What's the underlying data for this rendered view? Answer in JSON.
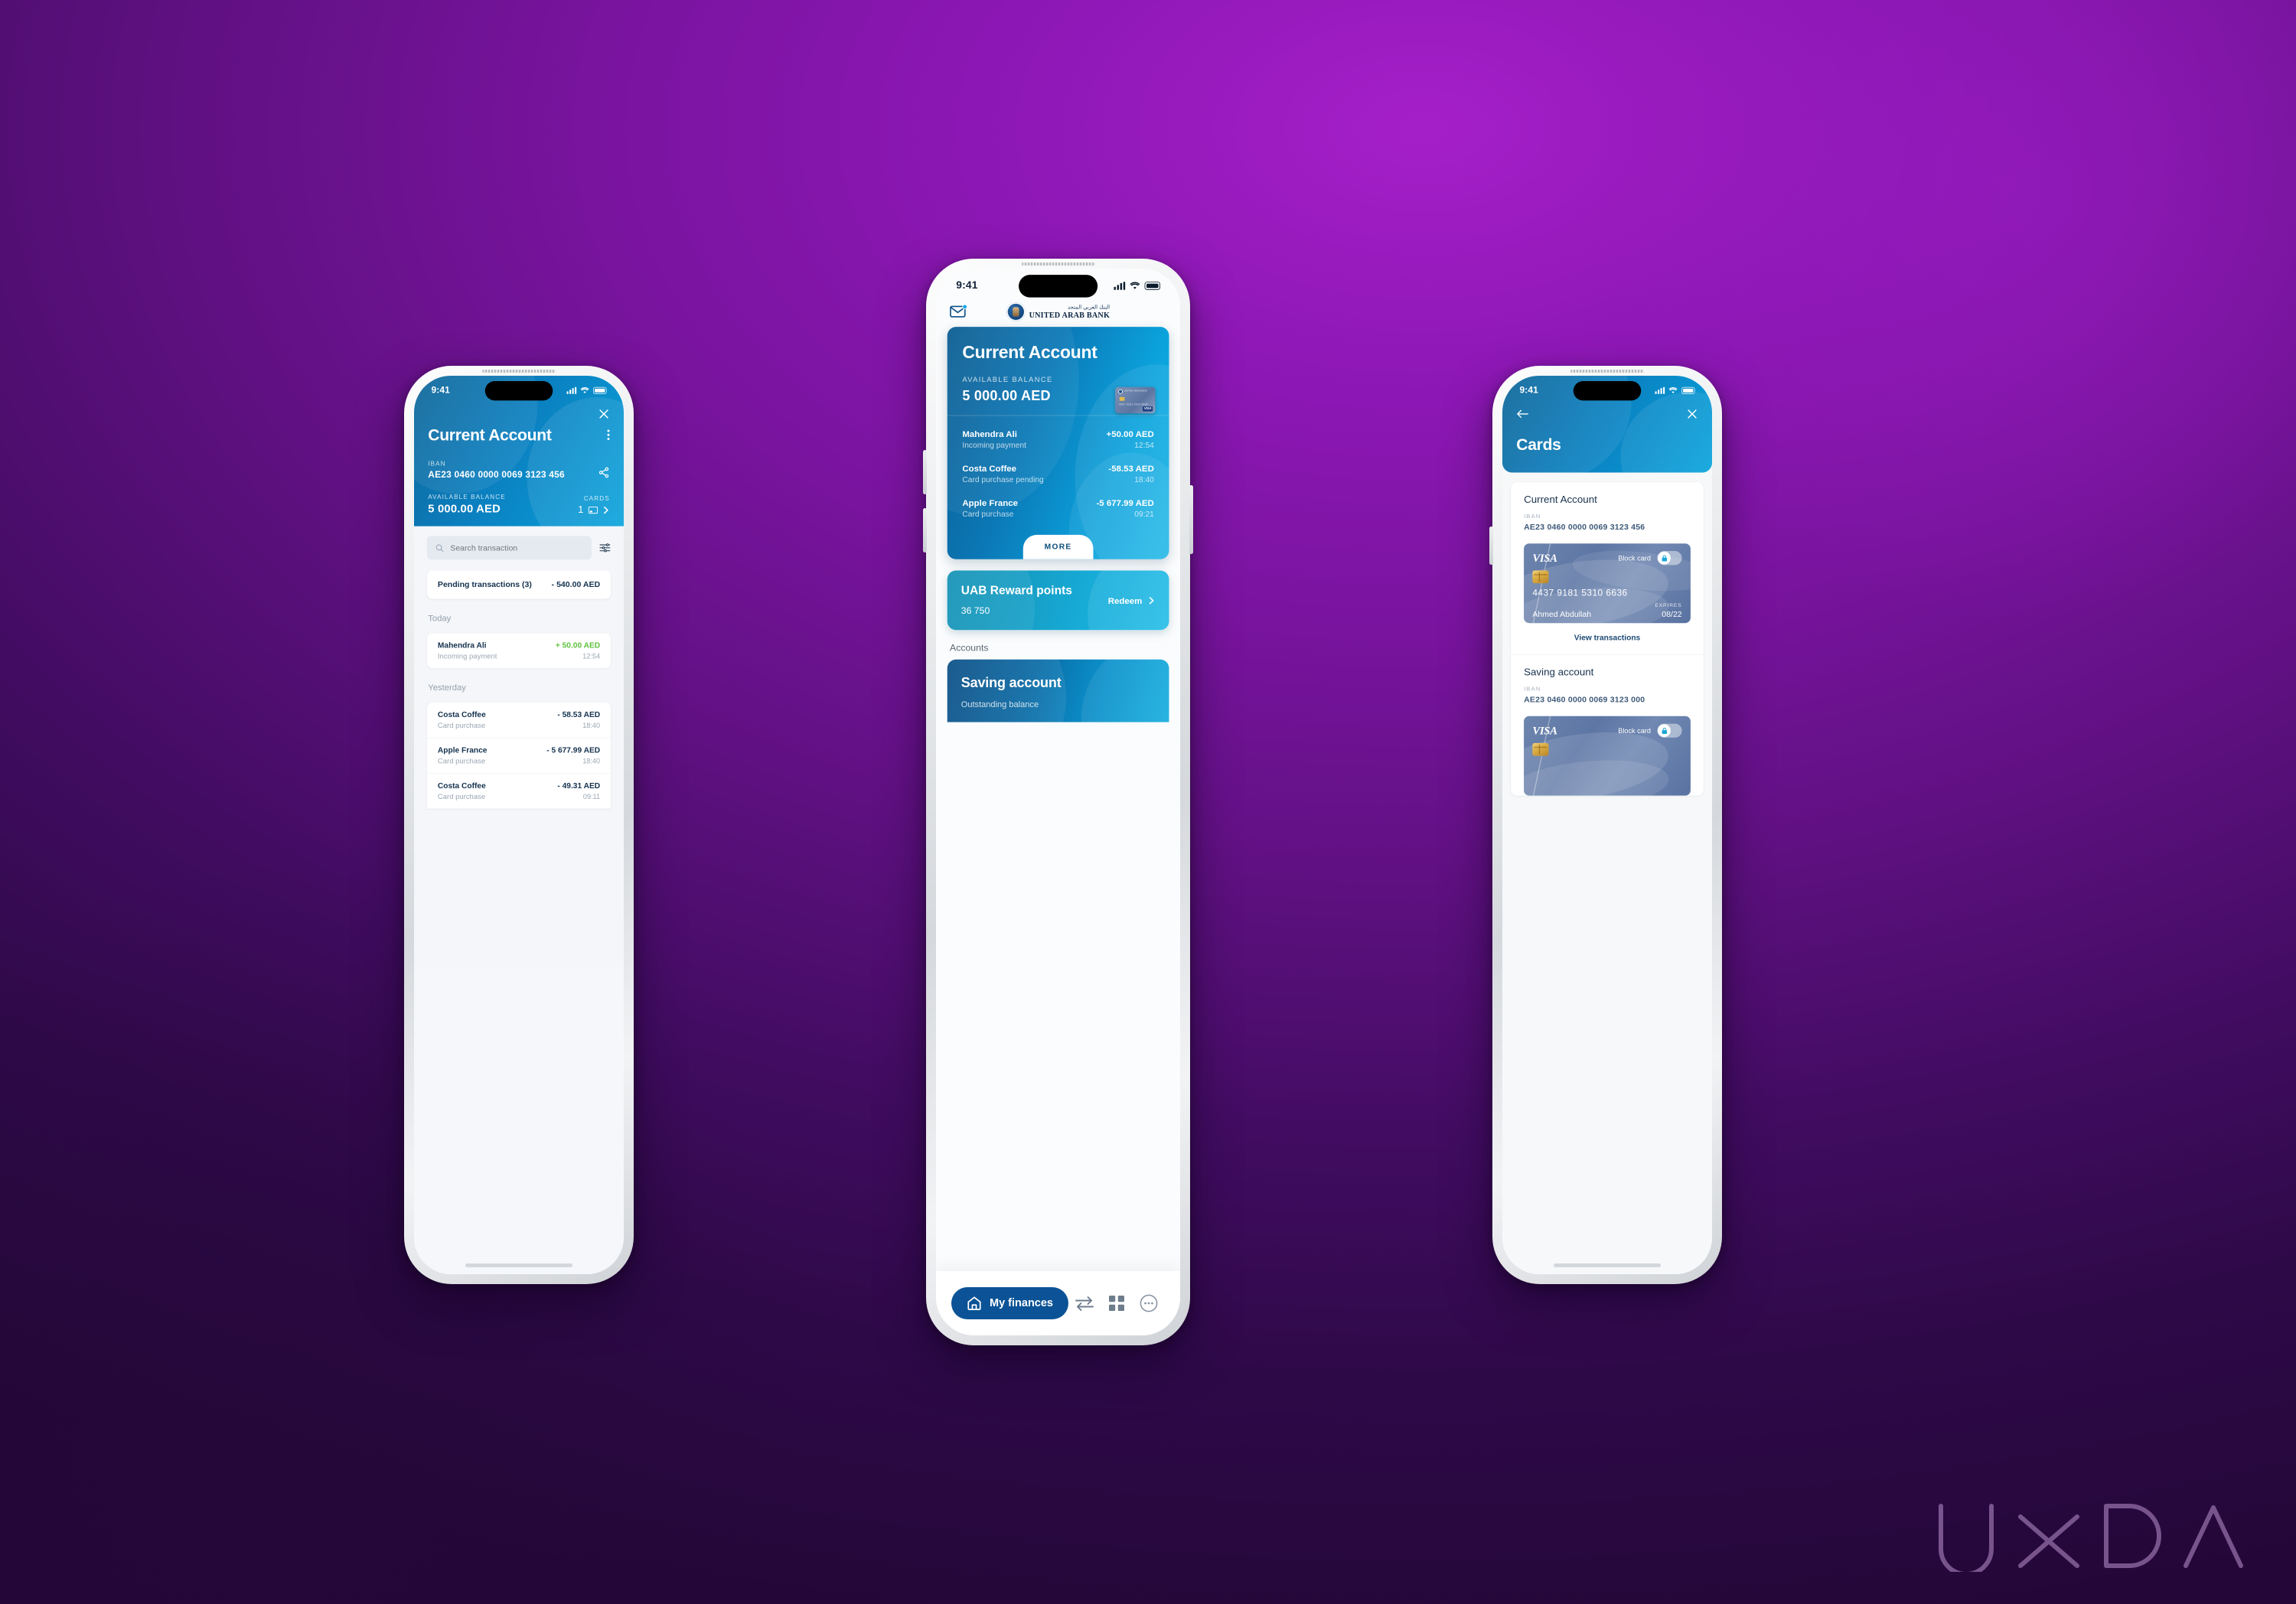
{
  "background": {
    "accent_purple": "#8415ad",
    "deep_purple": "#2a0b4e"
  },
  "brand": {
    "name_en": "UNITED ARAB BANK",
    "name_ar": "البنك العربي المتحد",
    "accent_blue": "#0b7fbf",
    "dark_blue": "#0b5396"
  },
  "watermark": {
    "text": "UXDA"
  },
  "status_bar": {
    "time": "9:41"
  },
  "left_phone": {
    "header": {
      "title": "Current Account",
      "iban_label": "IBAN",
      "iban_value": "AE23 0460 0000 0069 3123 456",
      "balance_label": "AVAILABLE BALANCE",
      "balance_value": "5 000.00 AED",
      "cards_label": "CARDS",
      "cards_count": "1",
      "close_icon": "close-icon",
      "menu_icon": "more-vertical-icon",
      "share_icon": "share-icon",
      "chevron_icon": "chevron-right-icon"
    },
    "search": {
      "placeholder": "Search transaction",
      "value": "",
      "filter_icon": "filter-sliders-icon",
      "search_icon": "search-icon"
    },
    "pending": {
      "label": "Pending transactions (3)",
      "amount": "- 540.00 AED"
    },
    "groups": [
      {
        "label": "Today",
        "items": [
          {
            "name": "Mahendra Ali",
            "subtitle": "Incoming payment",
            "amount": "+ 50.00 AED",
            "time": "12:54",
            "positive": true
          }
        ]
      },
      {
        "label": "Yesterday",
        "items": [
          {
            "name": "Costa Coffee",
            "subtitle": "Card purchase",
            "amount": "- 58.53 AED",
            "time": "18:40",
            "positive": false
          },
          {
            "name": "Apple France",
            "subtitle": "Card purchase",
            "amount": "- 5 677.99 AED",
            "time": "18:40",
            "positive": false
          },
          {
            "name": "Costa Coffee",
            "subtitle": "Card purchase",
            "amount": "- 49.31 AED",
            "time": "09:11",
            "positive": false
          }
        ]
      }
    ]
  },
  "center_phone": {
    "mail_icon": "mail-icon",
    "account_card": {
      "title": "Current Account",
      "balance_label": "AVAILABLE BALANCE",
      "balance_value": "5 000.00 AED",
      "more_label": "MORE",
      "transactions": [
        {
          "name": "Mahendra Ali",
          "subtitle": "Incoming payment",
          "amount": "+50.00 AED",
          "time": "12:54"
        },
        {
          "name": "Costa Coffee",
          "subtitle": "Card purchase pending",
          "amount": "-58.53 AED",
          "time": "18:40"
        },
        {
          "name": "Apple France",
          "subtitle": "Card purchase",
          "amount": "-5 677.99 AED",
          "time": "09:21"
        }
      ]
    },
    "rewards": {
      "title": "UAB Reward points",
      "points": "36 750",
      "action": "Redeem",
      "chevron_icon": "chevron-right-icon"
    },
    "accounts_heading": "Accounts",
    "saving_card": {
      "title": "Saving account",
      "subtitle": "Outstanding balance"
    },
    "tabbar": [
      {
        "label": "My finances",
        "icon": "home-icon",
        "active": true
      },
      {
        "label": "",
        "icon": "transfer-arrows-icon",
        "active": false
      },
      {
        "label": "",
        "icon": "grid-apps-icon",
        "active": false
      },
      {
        "label": "",
        "icon": "more-circle-icon",
        "active": false
      }
    ]
  },
  "right_phone": {
    "header": {
      "title": "Cards",
      "back_icon": "arrow-left-icon",
      "close_icon": "close-icon"
    },
    "sections": [
      {
        "title": "Current Account",
        "iban_label": "IBAN",
        "iban_value": "AE23 0460 0000 0069 3123 456",
        "card": {
          "brand": "VISA",
          "block_label": "Block card",
          "lock_icon": "lock-icon",
          "number": "4437 9181 5310 6636",
          "holder": "Ahmed Abdullah",
          "expires_label": "EXPIRES",
          "expires_value": "08/22"
        },
        "view_transactions": "View transactions"
      },
      {
        "title": "Saving account",
        "iban_label": "IBAN",
        "iban_value": "AE23 0460 0000 0069 3123 000",
        "card": {
          "brand": "VISA",
          "block_label": "Block card",
          "lock_icon": "lock-icon",
          "number": "",
          "holder": "",
          "expires_label": "",
          "expires_value": ""
        },
        "view_transactions": ""
      }
    ]
  }
}
